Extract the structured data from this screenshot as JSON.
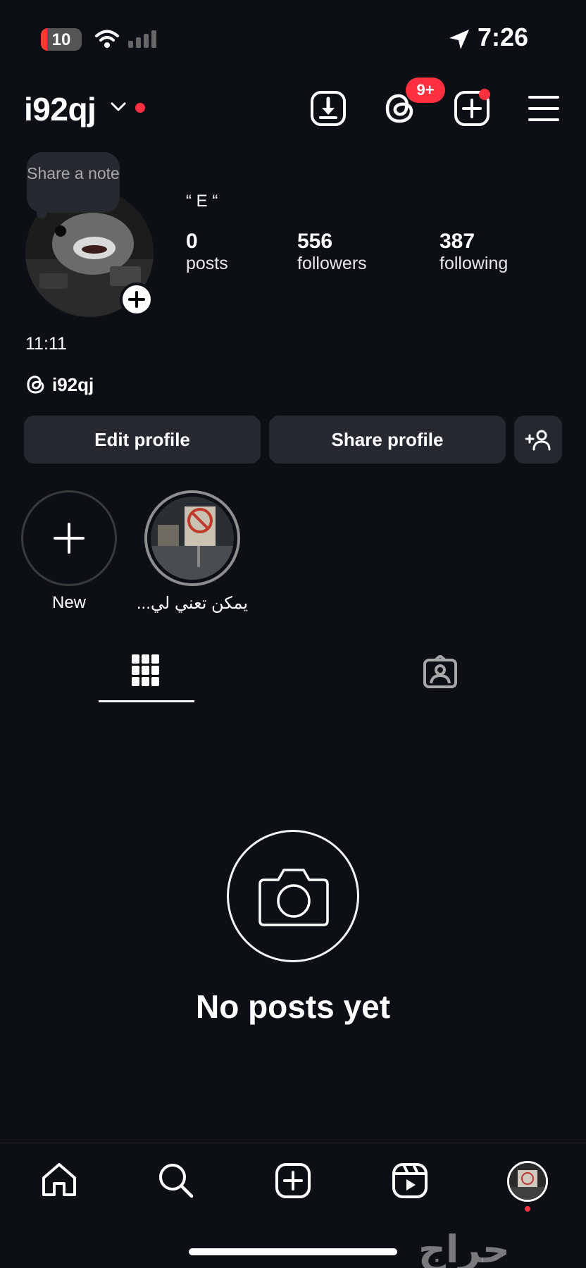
{
  "status_bar": {
    "time": "7:26",
    "battery": "10",
    "icons": [
      "wifi-icon",
      "cellular-icon",
      "location-arrow-icon"
    ]
  },
  "header": {
    "username": "i92qj",
    "badge": "9+",
    "icons": [
      "chevron-down-icon",
      "download-icon",
      "threads-icon",
      "add-post-icon",
      "menu-icon"
    ]
  },
  "profile": {
    "note": "Share a note",
    "name": "“ E “",
    "stats": [
      {
        "value": "0",
        "label": "posts"
      },
      {
        "value": "556",
        "label": "followers"
      },
      {
        "value": "387",
        "label": "following"
      }
    ],
    "bio": "11:11",
    "threads_handle": "i92qj"
  },
  "buttons": {
    "edit": "Edit profile",
    "share": "Share profile"
  },
  "highlights": [
    {
      "label": "New"
    },
    {
      "label": "يمكن تعني لي..."
    }
  ],
  "tabs": [
    "grid-icon",
    "tagged-icon"
  ],
  "empty_state": {
    "title": "No posts yet"
  },
  "bottom_nav": [
    "home-icon",
    "search-icon",
    "create-icon",
    "reels-icon",
    "profile-avatar"
  ],
  "watermark": "حراج",
  "colors": {
    "background": "#0c1014",
    "button": "#262a30",
    "accent_red": "#ff3040"
  }
}
